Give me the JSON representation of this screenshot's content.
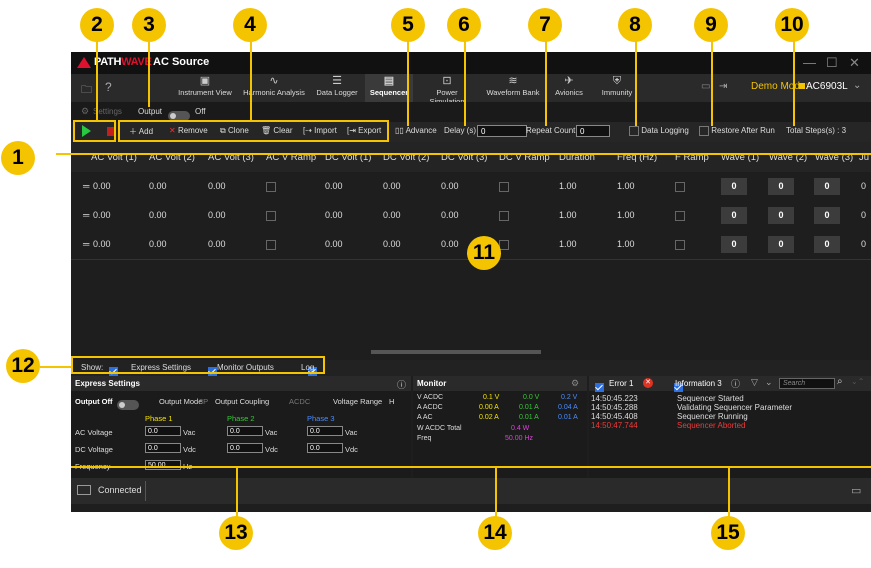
{
  "title_bar": {
    "brand_left": "PATH",
    "brand_right": "WAVE",
    "app_title": "AC Source"
  },
  "ribbon": {
    "tabs": [
      "Instrument View",
      "Harmonic Analysis",
      "Data Logger",
      "Sequencer",
      "Power Simulation",
      "Waveform Bank",
      "Avionics",
      "Immunity"
    ],
    "active_tab": "Sequencer",
    "demo_mode": "Demo Mode:",
    "device": "AC6903L"
  },
  "settings_row": {
    "settings_label": "Settings",
    "output_label": "Output",
    "output_state": "Off"
  },
  "toolbar": {
    "add": "Add",
    "remove": "Remove",
    "clone": "Clone",
    "clear": "Clear",
    "import": "Import",
    "export": "Export",
    "advance": "Advance",
    "delay_label": "Delay (s)",
    "delay_value": "0",
    "repeat_label": "Repeat Count",
    "repeat_value": "0",
    "data_logging": "Data Logging",
    "restore_after_run": "Restore After Run",
    "total_steps": "Total Steps(s) : 3"
  },
  "grid": {
    "columns": [
      "AC Volt (1)",
      "AC Volt (2)",
      "AC Volt (3)",
      "AC V Ramp",
      "DC Volt (1)",
      "DC Volt (2)",
      "DC Volt (3)",
      "DC V Ramp",
      "Duration",
      "Freq (Hz)",
      "F Ramp",
      "Wave (1)",
      "Wave (2)",
      "Wave (3)",
      "Ju"
    ],
    "rows": [
      [
        "0.00",
        "0.00",
        "0.00",
        "",
        "0.00",
        "0.00",
        "0.00",
        "",
        "1.00",
        "1.00",
        "",
        "0",
        "0",
        "0",
        "0"
      ],
      [
        "0.00",
        "0.00",
        "0.00",
        "",
        "0.00",
        "0.00",
        "0.00",
        "",
        "1.00",
        "1.00",
        "",
        "0",
        "0",
        "0",
        "0"
      ],
      [
        "0.00",
        "0.00",
        "0.00",
        "",
        "0.00",
        "0.00",
        "0.00",
        "",
        "1.00",
        "1.00",
        "",
        "0",
        "0",
        "0",
        "0"
      ]
    ]
  },
  "show_bar": {
    "show": "Show:",
    "express_settings": "Express Settings",
    "monitor_outputs": "Monitor Outputs",
    "log": "Log"
  },
  "express": {
    "title": "Express Settings",
    "output_off": "Output Off",
    "output_mode": "Output Mode",
    "output_mode_val": "3P",
    "output_coupling": "Output Coupling",
    "coupling_val": "ACDC",
    "voltage_range": "Voltage Range",
    "range_val": "H",
    "phase1": "Phase 1",
    "phase2": "Phase 2",
    "phase3": "Phase 3",
    "ac_voltage": "AC Voltage",
    "dc_voltage": "DC Voltage",
    "frequency": "Frequency",
    "vac": "Vac",
    "vdc": "Vdc",
    "hz": "Hz",
    "ac_vals": [
      "0.0",
      "0.0",
      "0.0"
    ],
    "dc_vals": [
      "0.0",
      "0.0",
      "0.0"
    ],
    "freq_val": "50.00"
  },
  "monitor": {
    "title": "Monitor",
    "rows": [
      {
        "label": "V ACDC",
        "v": [
          "0.1 V",
          "0.0 V",
          "0.2 V"
        ]
      },
      {
        "label": "A ACDC",
        "v": [
          "0.00 A",
          "0.01 A",
          "0.04 A"
        ]
      },
      {
        "label": "A AC",
        "v": [
          "0.02 A",
          "0.01 A",
          "0.01 A"
        ]
      }
    ],
    "w_label": "W ACDC Total",
    "w_val": "0.4 W",
    "freq_label": "Freq",
    "freq_val": "50.00 Hz",
    "colors": {
      "phase1": "#f5e400",
      "phase2": "#37c837",
      "phase3": "#4a8cff",
      "total": "#e040e0"
    }
  },
  "log": {
    "error": "Error 1",
    "information": "Information 3",
    "search_placeholder": "Search",
    "entries": [
      {
        "time": "14:50:45.223",
        "msg": "Sequencer Started",
        "level": "info"
      },
      {
        "time": "14:50:45.288",
        "msg": "Validating Sequencer Parameter",
        "level": "info"
      },
      {
        "time": "14:50:45.408",
        "msg": "Sequencer Running",
        "level": "info"
      },
      {
        "time": "14:50:47.744",
        "msg": "Sequencer Aborted",
        "level": "error"
      }
    ]
  },
  "status": {
    "connected": "Connected"
  },
  "callouts": [
    "1",
    "2",
    "3",
    "4",
    "5",
    "6",
    "7",
    "8",
    "9",
    "10",
    "11",
    "12",
    "13",
    "14",
    "15"
  ],
  "accent": "#f5c400"
}
